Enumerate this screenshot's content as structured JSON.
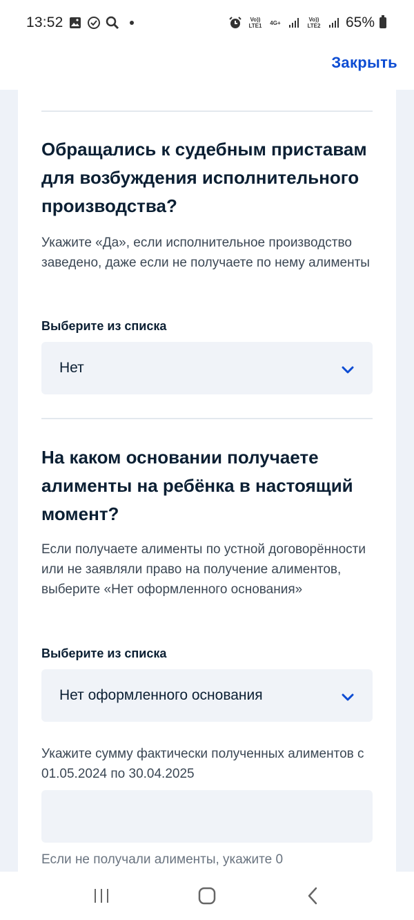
{
  "status_bar": {
    "time": "13:52",
    "sim1": "Vo)) LTE1",
    "net": "4G+",
    "sim2": "Vo)) LTE2",
    "battery": "65%"
  },
  "header": {
    "close_label": "Закрыть"
  },
  "form": {
    "q1": {
      "title": "Обращались к судебным приставам для возбуждения исполнительного производства?",
      "hint": "Укажите «Да», если исполнительное производство заведено, даже если не получаете по нему алименты",
      "field_label": "Выберите из списка",
      "selected": "Нет"
    },
    "q2": {
      "title": "На каком основании получаете алименты на ребёнка в настоящий момент?",
      "hint": "Если получаете алименты по устной договорённости или не заявляли право на получение алиментов, выберите «Нет оформленного основания»",
      "field_label": "Выберите из списка",
      "selected": "Нет оформленного основания"
    },
    "sum": {
      "label": "Укажите сумму фактически полученных алиментов с 01.05.2024 по 30.04.2025",
      "value": "",
      "hint": "Если не получали алименты, укажите 0"
    }
  },
  "colors": {
    "accent": "#0d4cd3",
    "text": "#0b1f33",
    "field_bg": "#f0f3f8",
    "page_bg": "#eef2f8"
  }
}
